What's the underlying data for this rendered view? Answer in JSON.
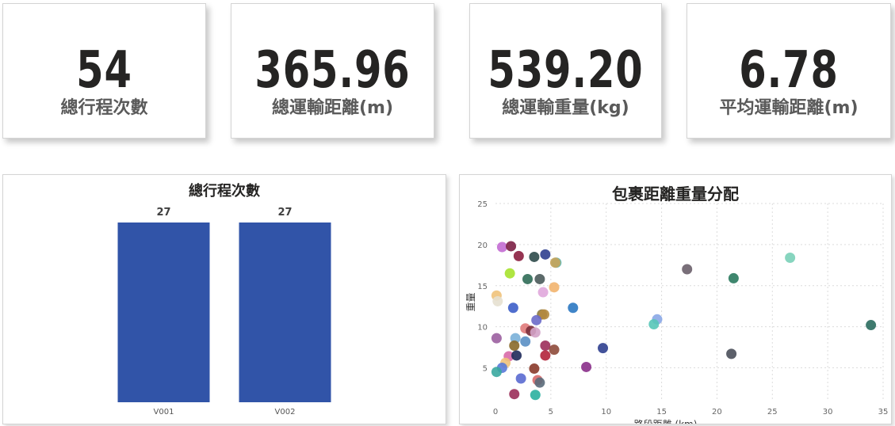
{
  "kpis": [
    {
      "value": "54",
      "label": "總行程次數"
    },
    {
      "value": "365.96",
      "label": "總運輸距離(m)"
    },
    {
      "value": "539.20",
      "label": "總運輸重量(kg)"
    },
    {
      "value": "6.78",
      "label": "平均運輸距離(m)"
    }
  ],
  "chart_data": [
    {
      "type": "bar",
      "title": "總行程次數",
      "categories": [
        "V001",
        "V002"
      ],
      "values": [
        27,
        27
      ],
      "data_labels": [
        "27",
        "27"
      ],
      "bar_color": "#3154a8",
      "ylim": [
        0,
        27
      ]
    },
    {
      "type": "scatter",
      "title": "包裹距離重量分配",
      "xlabel": "路段距離 (km)",
      "ylabel": "重量",
      "xlim": [
        0,
        35
      ],
      "ylim": [
        1,
        25
      ],
      "xticks": [
        0,
        5,
        10,
        15,
        20,
        25,
        30,
        35
      ],
      "yticks": [
        5,
        10,
        15,
        20,
        25
      ],
      "grid": true,
      "points": [
        {
          "x": 0.6,
          "y": 19.7,
          "color": "#c36bd3"
        },
        {
          "x": 1.4,
          "y": 19.8,
          "color": "#7b1f44"
        },
        {
          "x": 2.1,
          "y": 18.6,
          "color": "#8b1e3f"
        },
        {
          "x": 3.5,
          "y": 18.5,
          "color": "#2e4a4a"
        },
        {
          "x": 4.5,
          "y": 18.8,
          "color": "#2f3f8f"
        },
        {
          "x": 5.5,
          "y": 17.8,
          "color": "#5fb6ae"
        },
        {
          "x": 5.4,
          "y": 17.8,
          "color": "#c7a35a"
        },
        {
          "x": 1.3,
          "y": 16.5,
          "color": "#a6e22e"
        },
        {
          "x": 2.9,
          "y": 15.8,
          "color": "#2f6b57"
        },
        {
          "x": 4.0,
          "y": 15.8,
          "color": "#4a5a5a"
        },
        {
          "x": 5.3,
          "y": 14.8,
          "color": "#f2b46e"
        },
        {
          "x": 4.3,
          "y": 14.2,
          "color": "#e0a7dc"
        },
        {
          "x": 0.1,
          "y": 13.8,
          "color": "#f0c27a"
        },
        {
          "x": 0.2,
          "y": 13.1,
          "color": "#e6e0d0"
        },
        {
          "x": 1.6,
          "y": 12.3,
          "color": "#3c5ec9"
        },
        {
          "x": 7.0,
          "y": 12.3,
          "color": "#2b78c2"
        },
        {
          "x": 4.2,
          "y": 11.5,
          "color": "#8c7a3f"
        },
        {
          "x": 4.4,
          "y": 11.5,
          "color": "#b58a3f"
        },
        {
          "x": 3.7,
          "y": 10.8,
          "color": "#6a6ac9"
        },
        {
          "x": 14.6,
          "y": 10.9,
          "color": "#8aa7e6"
        },
        {
          "x": 14.3,
          "y": 10.3,
          "color": "#56c6b8"
        },
        {
          "x": 33.9,
          "y": 10.2,
          "color": "#2a6b5e"
        },
        {
          "x": 2.7,
          "y": 9.8,
          "color": "#e07a7a"
        },
        {
          "x": 3.2,
          "y": 9.5,
          "color": "#7a2e3a"
        },
        {
          "x": 3.6,
          "y": 9.3,
          "color": "#d3a3c8"
        },
        {
          "x": 0.1,
          "y": 8.6,
          "color": "#9b5fa0"
        },
        {
          "x": 1.8,
          "y": 8.6,
          "color": "#7ab0d8"
        },
        {
          "x": 2.7,
          "y": 8.2,
          "color": "#5a8fc4"
        },
        {
          "x": 1.7,
          "y": 7.7,
          "color": "#8a6a2a"
        },
        {
          "x": 4.5,
          "y": 7.7,
          "color": "#9c2e5a"
        },
        {
          "x": 5.3,
          "y": 7.2,
          "color": "#8e4a3a"
        },
        {
          "x": 9.7,
          "y": 7.4,
          "color": "#2f3f8f"
        },
        {
          "x": 21.3,
          "y": 6.7,
          "color": "#4a4f5a"
        },
        {
          "x": 1.2,
          "y": 6.4,
          "color": "#d86aa8"
        },
        {
          "x": 1.9,
          "y": 6.5,
          "color": "#1e2a5a"
        },
        {
          "x": 4.5,
          "y": 6.5,
          "color": "#b2233a"
        },
        {
          "x": 0.9,
          "y": 5.6,
          "color": "#f0c27a"
        },
        {
          "x": 0.6,
          "y": 5.0,
          "color": "#5a7ad8"
        },
        {
          "x": 3.5,
          "y": 4.9,
          "color": "#8a3a2a"
        },
        {
          "x": 8.2,
          "y": 5.1,
          "color": "#8a2f8a"
        },
        {
          "x": 0.1,
          "y": 4.5,
          "color": "#3aa8a0"
        },
        {
          "x": 2.3,
          "y": 3.7,
          "color": "#5a6ad0"
        },
        {
          "x": 3.8,
          "y": 3.5,
          "color": "#d86a6a"
        },
        {
          "x": 4.0,
          "y": 3.2,
          "color": "#5a6a7a"
        },
        {
          "x": 1.7,
          "y": 1.8,
          "color": "#9b2f5a"
        },
        {
          "x": 3.6,
          "y": 1.7,
          "color": "#2ab0a0"
        },
        {
          "x": 17.3,
          "y": 17.0,
          "color": "#6a5f6a"
        },
        {
          "x": 21.5,
          "y": 15.9,
          "color": "#2a7a5e"
        },
        {
          "x": 26.6,
          "y": 18.4,
          "color": "#7ad0b8"
        }
      ]
    }
  ]
}
